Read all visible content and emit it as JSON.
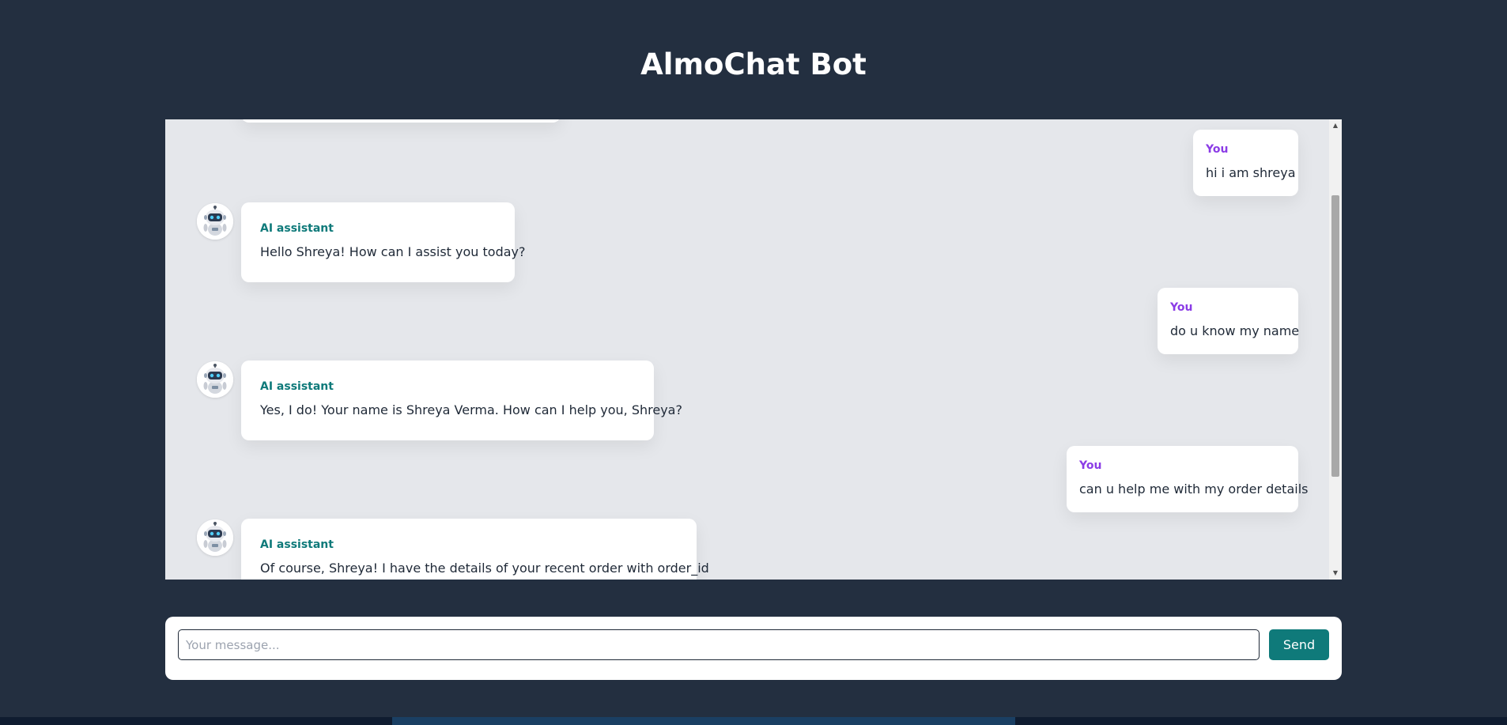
{
  "app": {
    "title": "AlmoChat Bot"
  },
  "chat": {
    "messages": [
      {
        "role": "user",
        "sender": "You",
        "text": "hi i am shreya"
      },
      {
        "role": "bot",
        "sender": "AI assistant",
        "text": "Hello Shreya! How can I assist you today?"
      },
      {
        "role": "user",
        "sender": "You",
        "text": "do u know my name"
      },
      {
        "role": "bot",
        "sender": "AI assistant",
        "text": "Yes, I do! Your name is Shreya Verma. How can I help you, Shreya?"
      },
      {
        "role": "user",
        "sender": "You",
        "text": "can u help me with my order details"
      },
      {
        "role": "bot",
        "sender": "AI assistant",
        "text": "Of course, Shreya! I have the details of your recent order with order_id"
      }
    ],
    "avatar_icon": "robot-avatar-icon"
  },
  "composer": {
    "placeholder": "Your message...",
    "value": "",
    "send_label": "Send"
  },
  "colors": {
    "page_background": "#232f40",
    "chat_background": "#e5e7eb",
    "user_label": "#8b3ce6",
    "bot_label": "#0f7a7a",
    "send_button": "#0f7a7a"
  }
}
